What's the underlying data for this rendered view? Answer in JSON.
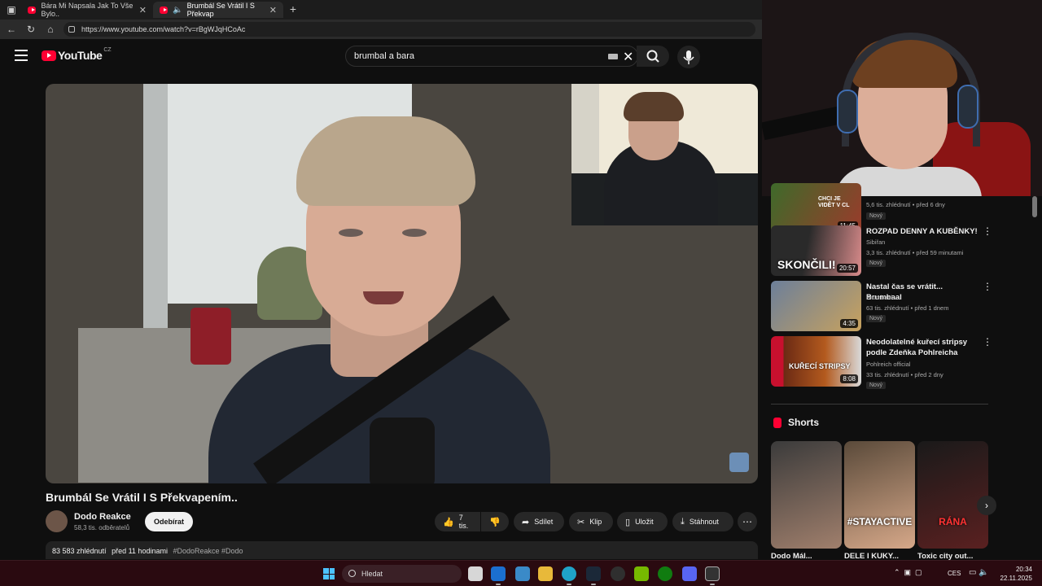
{
  "browser": {
    "tabs": [
      {
        "title": "Bára Mi Napsala Jak To Vše Bylo.."
      },
      {
        "title": "Brumbál Se Vrátil I S Překvap"
      }
    ],
    "new_tab": "+",
    "url": "https://www.youtube.com/watch?v=rBgWJqHCoAc"
  },
  "youtube": {
    "logo_text": "YouTube",
    "country": "CZ",
    "search_query": "brumbal a bara"
  },
  "video": {
    "title": "Brumbál Se Vrátil I S Překvapením..",
    "channel": "Dodo Reakce",
    "subscribers": "58,3 tis. odběratelů",
    "subscribe_label": "Odebírat",
    "likes": "7 tis.",
    "share_label": "Sdílet",
    "clip_label": "Klip",
    "save_label": "Uložit",
    "download_label": "Stáhnout",
    "views": "83 583 zhlédnutí",
    "age": "před 11 hodinami",
    "tags": "#DodoReakce #Dodo"
  },
  "sidebar": {
    "related": [
      {
        "title": "",
        "channel": "",
        "meta": "5,6 tis. zhlédnutí • před 6 dny",
        "badge": "Nový",
        "duration": "11:45",
        "thumb_text": "CHCI JE VIDĚT V CL"
      },
      {
        "title": "ROZPAD DENNY A KUBĚNKY!",
        "channel": "Sibiřan",
        "meta": "3,3 tis. zhlédnutí • před 59 minutami",
        "badge": "Nový",
        "duration": "20:57",
        "thumb_text": "SKONČILI!"
      },
      {
        "title": "Nastal čas se vrátit... Brumbaal",
        "channel": "Brumbaal",
        "meta": "63 tis. zhlédnutí • před 1 dnem",
        "badge": "Nový",
        "duration": "4:35",
        "thumb_text": ""
      },
      {
        "title": "Neodolatelné kuřecí stripsy podle Zdeňka Pohlreicha",
        "channel": "Pohlreich official",
        "meta": "33 tis. zhlédnutí • před 2 dny",
        "badge": "Nový",
        "duration": "8:08",
        "thumb_text": "KUŘECÍ STRIPSY"
      }
    ],
    "shorts_heading": "Shorts",
    "shorts": [
      {
        "caption": "",
        "label": "Dodo Mál..."
      },
      {
        "caption": "#STAYACTIVE",
        "label": "DELE I KUKY..."
      },
      {
        "caption": "RÁNA",
        "label": "Toxic city out..."
      }
    ]
  },
  "taskbar": {
    "search_placeholder": "Hledat",
    "language": "CES",
    "time": "20:34",
    "date": "22.11.2025"
  },
  "colors": {
    "youtube_red": "#ff0033",
    "page_bg": "#0f0f0f",
    "taskbar_bg": "#2a0a10"
  }
}
